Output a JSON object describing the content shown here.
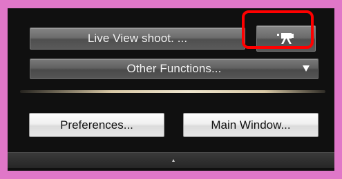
{
  "panel": {
    "live_view_label": "Live View shoot. ...",
    "other_functions_label": "Other Functions...",
    "preferences_label": "Preferences...",
    "main_window_label": "Main Window..."
  },
  "icons": {
    "movie": "movie-camera-icon",
    "dropdown": "chevron-down-icon",
    "collapse": "chevron-up-icon"
  },
  "colors": {
    "background": "#e077c8",
    "panel": "#101010",
    "highlight": "#ff0000"
  }
}
